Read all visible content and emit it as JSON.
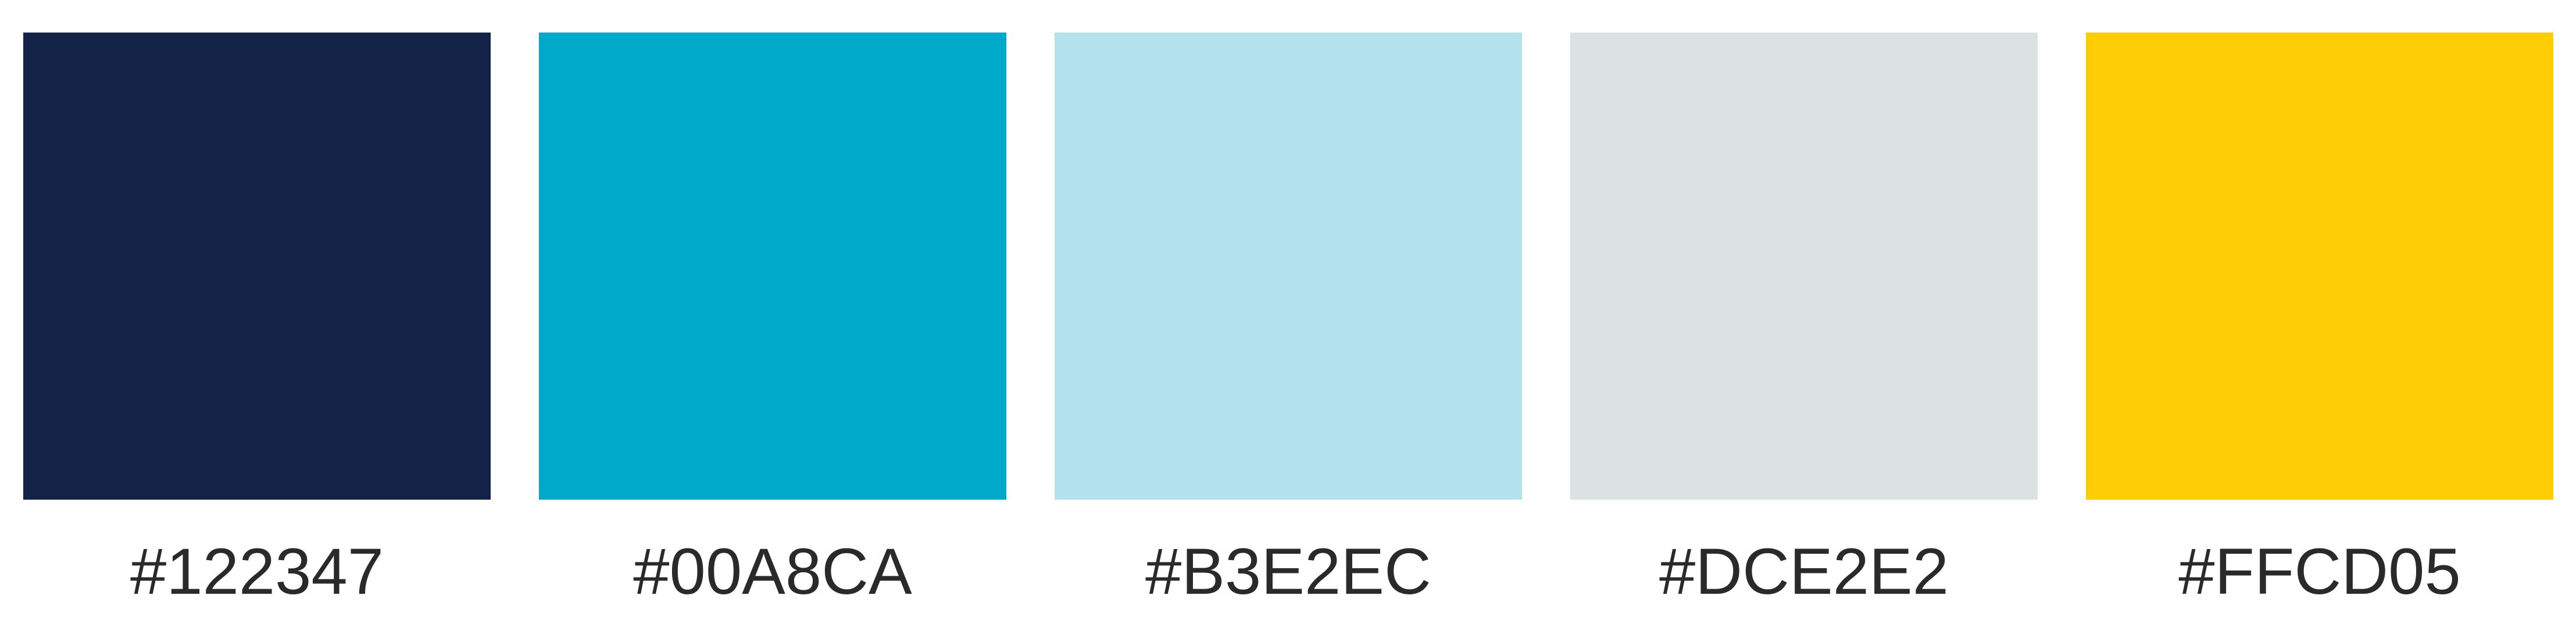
{
  "swatches": [
    {
      "hex": "#122347",
      "label": "#122347"
    },
    {
      "hex": "#00A8CA",
      "label": "#00A8CA"
    },
    {
      "hex": "#B3E2EC",
      "label": "#B3E2EC"
    },
    {
      "hex": "#DCE2E2",
      "label": "#DCE2E2"
    },
    {
      "hex": "#FFCD05",
      "label": "#FFCD05"
    }
  ]
}
